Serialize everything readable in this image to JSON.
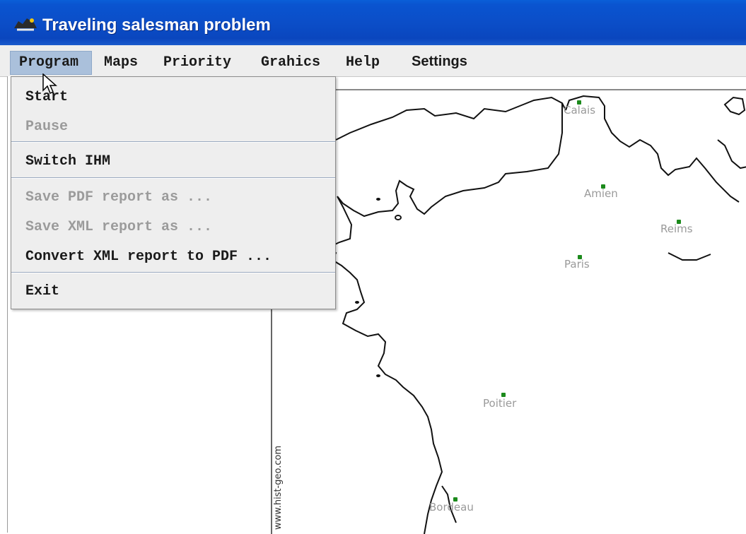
{
  "window": {
    "title": "Traveling salesman problem",
    "title_bar_color": "#0b4ec8"
  },
  "menubar": {
    "items": [
      "Program",
      "Maps",
      "Priority",
      "Grahics",
      "Help",
      "Settings"
    ],
    "active": "Program",
    "active_color": "#aac0db"
  },
  "program_menu": {
    "items": [
      {
        "label": "Start",
        "enabled": true
      },
      {
        "label": "Pause",
        "enabled": false
      },
      {
        "label": "Switch IHM",
        "enabled": true
      },
      {
        "label": "Save PDF report as ...",
        "enabled": false
      },
      {
        "label": "Save XML report as ...",
        "enabled": false
      },
      {
        "label": "Convert XML report to PDF ...",
        "enabled": true
      },
      {
        "label": "Exit",
        "enabled": true
      }
    ]
  },
  "map": {
    "cities": [
      "Calais",
      "Amien",
      "Reims",
      "Paris",
      "Poitier",
      "Bordeau"
    ],
    "city_color": "#1c8a1c",
    "credit": "www.hist-geo.com"
  }
}
